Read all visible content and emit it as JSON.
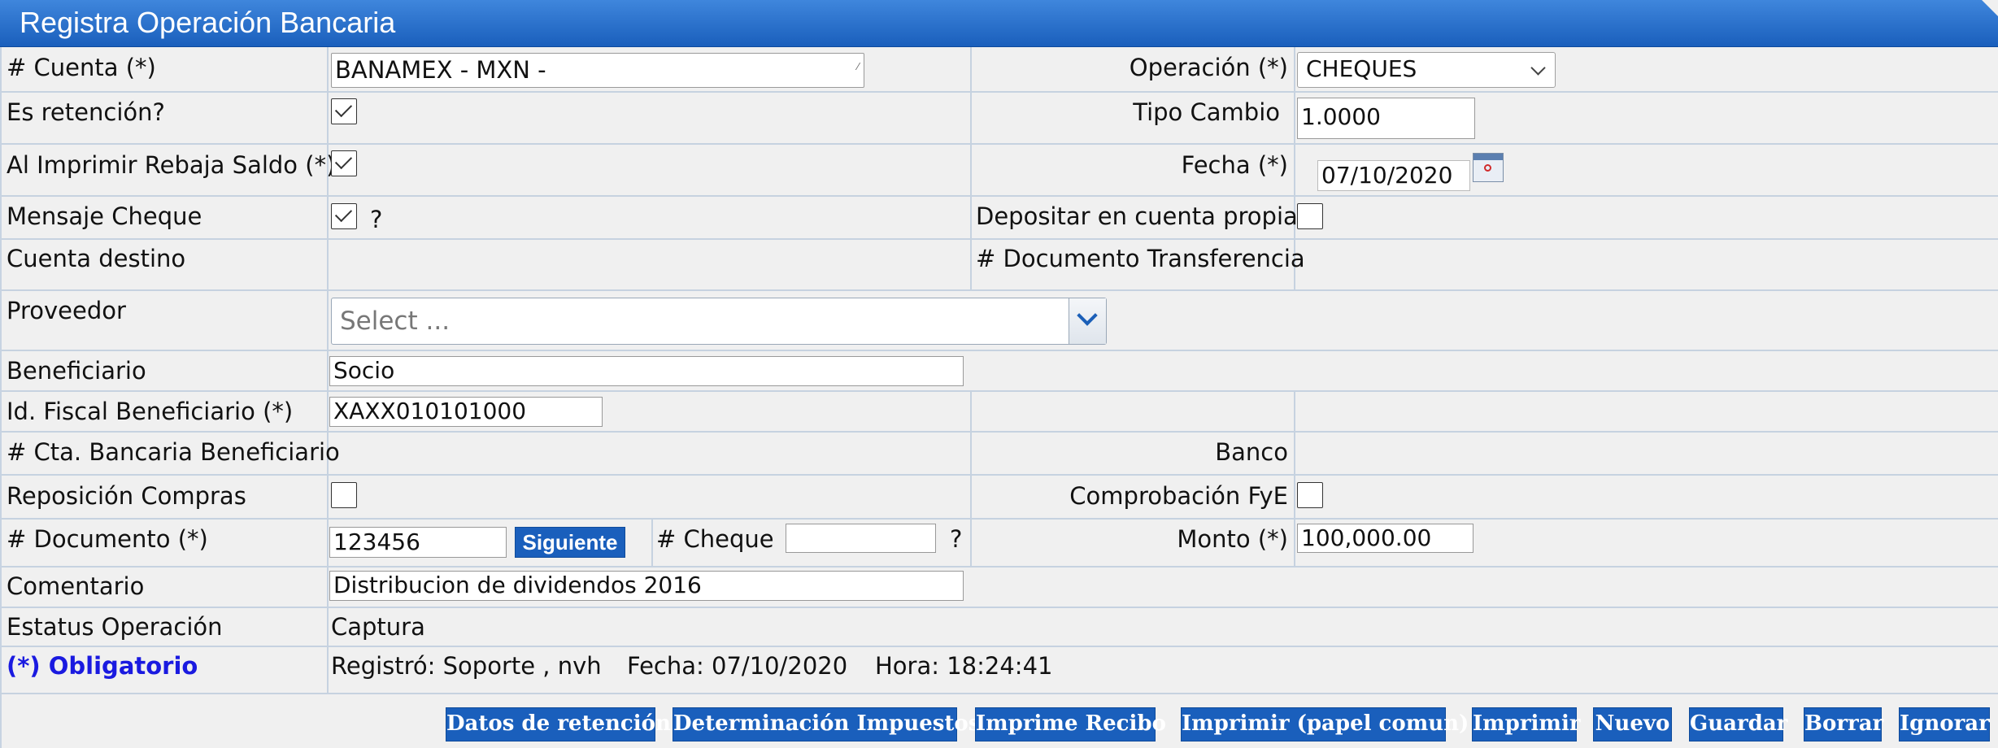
{
  "window": {
    "title": "Registra Operación Bancaria"
  },
  "form": {
    "cuenta": {
      "label": "# Cuenta (*)",
      "value": "BANAMEX - MXN -"
    },
    "operacion": {
      "label": "Operación (*)",
      "value": "CHEQUES"
    },
    "es_retencion": {
      "label": "Es retención?",
      "checked": true
    },
    "tipo_cambio": {
      "label": "Tipo Cambio",
      "value": "1.0000"
    },
    "rebaja_saldo": {
      "label": "Al Imprimir Rebaja Saldo (*)",
      "checked": true
    },
    "fecha": {
      "label": "Fecha (*)",
      "value": "07/10/2020"
    },
    "mensaje_cheque": {
      "label": "Mensaje Cheque",
      "checked": true,
      "help": "?"
    },
    "depositar_cuenta_propia": {
      "label": "Depositar en cuenta propia",
      "checked": false
    },
    "cuenta_destino": {
      "label": "Cuenta destino"
    },
    "documento_transferencia": {
      "label": "# Documento Transferencia"
    },
    "proveedor": {
      "label": "Proveedor",
      "placeholder": "Select ..."
    },
    "beneficiario": {
      "label": "Beneficiario",
      "value": "Socio"
    },
    "id_fiscal": {
      "label": "Id. Fiscal Beneficiario (*)",
      "value": "XAXX010101000"
    },
    "cta_bancaria": {
      "label": "# Cta. Bancaria Beneficiario"
    },
    "banco": {
      "label": "Banco"
    },
    "reposicion_compras": {
      "label": "Reposición Compras",
      "checked": false
    },
    "comprobacion_fye": {
      "label": "Comprobación FyE",
      "checked": false
    },
    "documento": {
      "label": "# Documento (*)",
      "value": "123456",
      "next_button": "Siguiente"
    },
    "cheque": {
      "label": "# Cheque",
      "value": "",
      "help": "?"
    },
    "monto": {
      "label": "Monto (*)",
      "value": "100,000.00"
    },
    "comentario": {
      "label": "Comentario",
      "value": "Distribucion de dividendos 2016"
    },
    "estatus": {
      "label": "Estatus Operación",
      "value": "Captura"
    },
    "obligatorio": {
      "label": "(*) Obligatorio"
    },
    "registro": {
      "registro": "Registró: Soporte , nvh",
      "fecha": "Fecha: 07/10/2020",
      "hora": "Hora: 18:24:41"
    }
  },
  "actions": {
    "datos_retencion": "Datos de retención",
    "determinacion": "Determinación Impuestos",
    "imprime_recibo": "Imprime Recibo",
    "imprimir_papel": "Imprimir (papel comun)",
    "imprimir": "Imprimir",
    "nuevo": "Nuevo",
    "guardar": "Guardar",
    "borrar": "Borrar",
    "ignorar": "Ignorar"
  },
  "colors": {
    "header": "#1a5fbc",
    "button": "#1a5fbc",
    "required": "#1a1ae0"
  }
}
